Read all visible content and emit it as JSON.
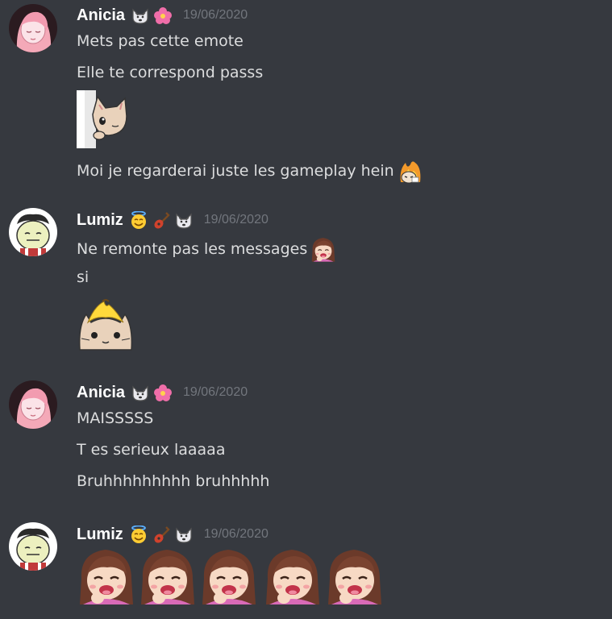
{
  "messages": [
    {
      "author": "Anicia",
      "timestamp": "19/06/2020",
      "badges": [
        "wolf-icon",
        "hibiscus-icon"
      ],
      "lines": [
        "Mets pas cette emote",
        "Elle te correspond passs",
        "Moi je regarderai juste les gameplay hein"
      ]
    },
    {
      "author": "Lumiz",
      "timestamp": "19/06/2020",
      "badges": [
        "halo-smile-icon",
        "guitar-icon",
        "wolf-icon"
      ],
      "lines": [
        "Ne remonte pas les messages",
        "si"
      ]
    },
    {
      "author": "Anicia",
      "timestamp": "19/06/2020",
      "badges": [
        "wolf-icon",
        "hibiscus-icon"
      ],
      "lines": [
        "MAISSSSS",
        "T es serieux laaaaa",
        "Bruhhhhhhhhh bruhhhhh"
      ]
    },
    {
      "author": "Lumiz",
      "timestamp": "19/06/2020",
      "badges": [
        "halo-smile-icon",
        "guitar-icon",
        "wolf-icon"
      ],
      "lines": []
    }
  ],
  "colors": {
    "background": "#36393f",
    "text": "#dcddde",
    "author": "#ffffff",
    "timestamp": "#72767d",
    "anicia_avatar_bg": "#f4a9b8"
  }
}
